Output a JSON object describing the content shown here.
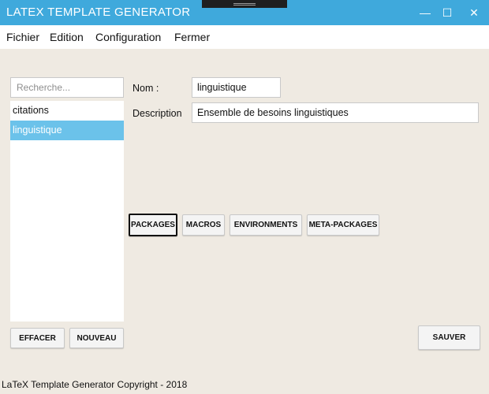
{
  "window": {
    "title": "LATEX TEMPLATE GENERATOR",
    "minimize": "—",
    "maximize": "☐",
    "close": "✕"
  },
  "menu": [
    "Fichier",
    "Edition",
    "Configuration",
    "Fermer"
  ],
  "sidebar": {
    "search_placeholder": "Recherche...",
    "items": [
      {
        "label": "citations",
        "selected": false
      },
      {
        "label": "linguistique",
        "selected": true
      }
    ],
    "buttons": {
      "clear": "EFFACER",
      "new": "NOUVEAU"
    }
  },
  "form": {
    "name_label": "Nom :",
    "name_value": "linguistique",
    "description_label": "Description",
    "description_value": "Ensemble de besoins linguistiques"
  },
  "tabs": [
    "PACKAGES",
    "MACROS",
    "ENVIRONMENTS",
    "META-PACKAGES"
  ],
  "actions": {
    "save": "SAUVER"
  },
  "footer": "LaTeX Template Generator Copyright - 2018",
  "colors": {
    "titlebar": "#3fa9dc",
    "selection": "#6bc2ea",
    "background": "#efeae2"
  }
}
